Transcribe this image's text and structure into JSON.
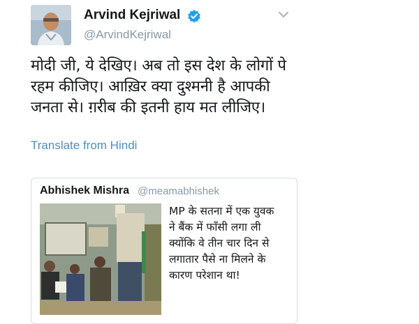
{
  "tweet": {
    "author_name": "Arvind Kejriwal",
    "author_handle": "@ArvindKejriwal",
    "text_lines": [
      "मोदी जी, ये देखिए। अब तो इस देश के लोगों पे",
      "रहम कीजिए। आख़िर क्या दुश्मनी है आपकी",
      "जनता से। ग़रीब की इतनी हाय मत लीजिए।"
    ],
    "translate_label": "Translate from Hindi",
    "verified_icon": "verified-badge-icon",
    "menu_icon": "chevron-down-icon"
  },
  "quoted_tweet": {
    "author_name": "Abhishek Mishra",
    "author_handle": "@meamabhishek",
    "text_lines": [
      "MP के सतना में एक युवक",
      "ने बैंक में फाँसी लगा ली",
      "क्योंकि वे तीन चार दिन से",
      "लगातार पैसे ना मिलने के",
      "कारण परेशान था!"
    ],
    "photo": "photo-bank-scene"
  },
  "colors": {
    "link": "#4a90c8",
    "verified": "#1da1f2",
    "muted": "#8899a6",
    "text": "#14171a",
    "border": "#d6dde3"
  }
}
